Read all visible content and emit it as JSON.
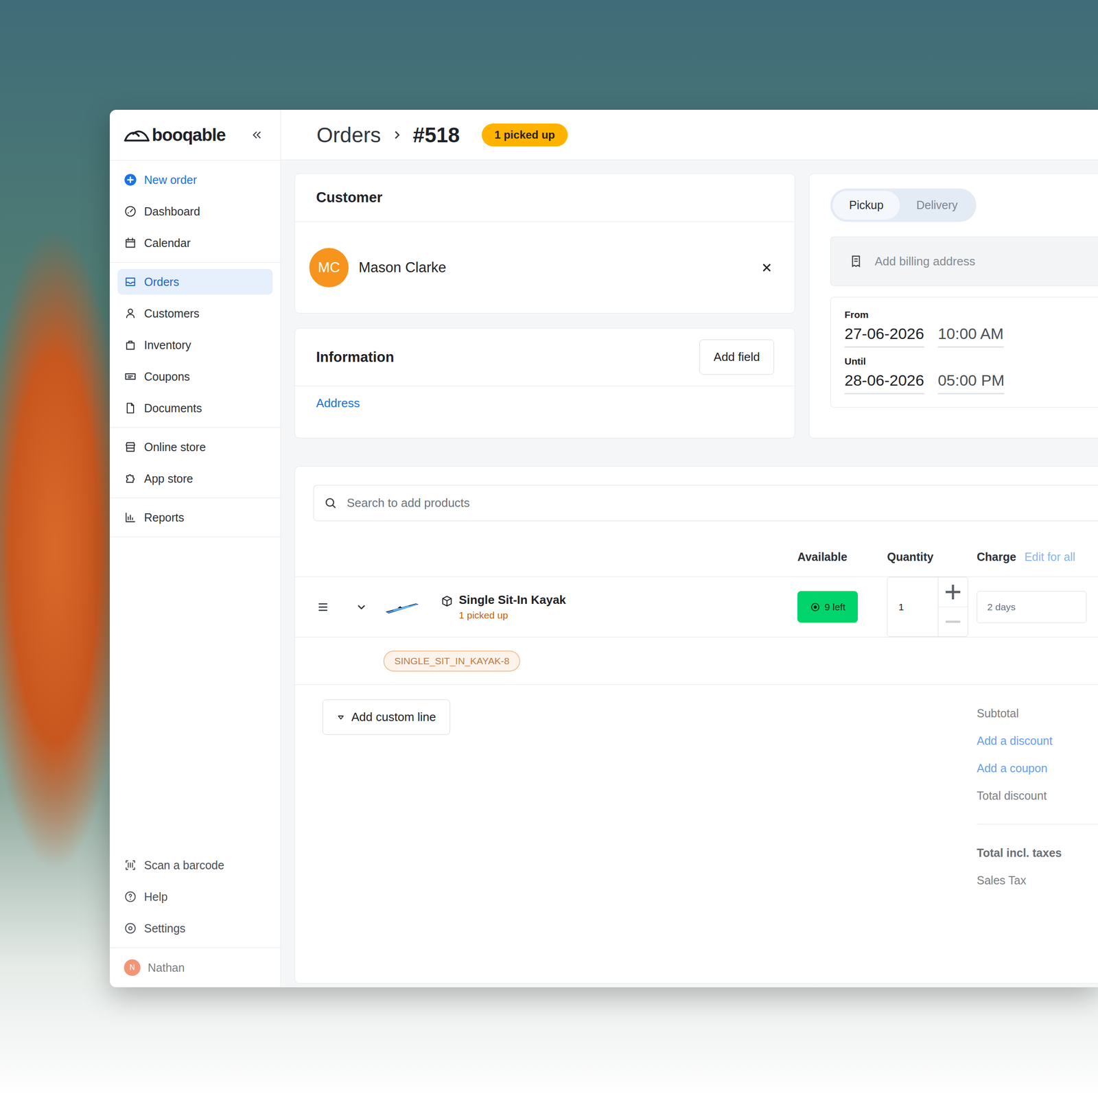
{
  "logo": {
    "text": "booqable"
  },
  "sidebar": {
    "groups": [
      {
        "items": [
          {
            "label": "New order",
            "kind": "action",
            "selected": false
          },
          {
            "label": "Dashboard",
            "kind": "link",
            "selected": false
          },
          {
            "label": "Calendar",
            "kind": "link",
            "selected": false
          }
        ]
      },
      {
        "items": [
          {
            "label": "Orders",
            "kind": "link",
            "selected": true
          },
          {
            "label": "Customers",
            "kind": "link",
            "selected": false
          },
          {
            "label": "Inventory",
            "kind": "link",
            "selected": false
          },
          {
            "label": "Coupons",
            "kind": "link",
            "selected": false
          },
          {
            "label": "Documents",
            "kind": "link",
            "selected": false
          }
        ]
      },
      {
        "items": [
          {
            "label": "Online store",
            "kind": "link",
            "selected": false
          },
          {
            "label": "App store",
            "kind": "link",
            "selected": false
          }
        ]
      },
      {
        "items": [
          {
            "label": "Reports",
            "kind": "link",
            "selected": false
          }
        ]
      }
    ],
    "bottom": [
      {
        "label": "Scan a barcode"
      },
      {
        "label": "Help"
      },
      {
        "label": "Settings"
      }
    ],
    "user": {
      "initial": "N",
      "name": "Nathan"
    }
  },
  "header": {
    "breadcrumb": "Orders",
    "order_number": "#518",
    "status_badge": "1 picked up"
  },
  "customer": {
    "title": "Customer",
    "initials": "MC",
    "name": "Mason Clarke"
  },
  "information": {
    "title": "Information",
    "button": "Add field",
    "fields": [
      {
        "label": "Address"
      }
    ]
  },
  "fulfillment": {
    "tabs": [
      {
        "label": "Pickup",
        "selected": true
      },
      {
        "label": "Delivery",
        "selected": false
      }
    ],
    "billing_placeholder": "Add billing address",
    "period": [
      {
        "label": "From",
        "date": "27-06-2026",
        "time": "10:00 AM"
      },
      {
        "label": "Until",
        "date": "28-06-2026",
        "time": "05:00 PM"
      }
    ]
  },
  "products": {
    "search_placeholder": "Search to add products",
    "columns": [
      {
        "label": "Available",
        "action": ""
      },
      {
        "label": "Quantity",
        "action": ""
      },
      {
        "label": "Charge",
        "action": "Edit for all"
      }
    ],
    "lines": [
      {
        "name": "Single Sit-In Kayak",
        "status": "1 picked up",
        "available": "9 left",
        "available_ok": true,
        "quantity": "1",
        "decrease_disabled": true,
        "charge": "2 days",
        "identifiers": [
          "SINGLE_SIT_IN_KAYAK-8"
        ],
        "expanded": true
      }
    ],
    "add_custom_line": "Add custom line",
    "totals": [
      {
        "label": "Subtotal",
        "kind": "label"
      },
      {
        "label": "Add a discount",
        "kind": "link"
      },
      {
        "label": "Add a coupon",
        "kind": "link"
      },
      {
        "label": "Total discount",
        "kind": "label"
      },
      {
        "label": "Total incl. taxes",
        "kind": "total"
      },
      {
        "label": "Sales Tax",
        "kind": "label"
      }
    ]
  }
}
